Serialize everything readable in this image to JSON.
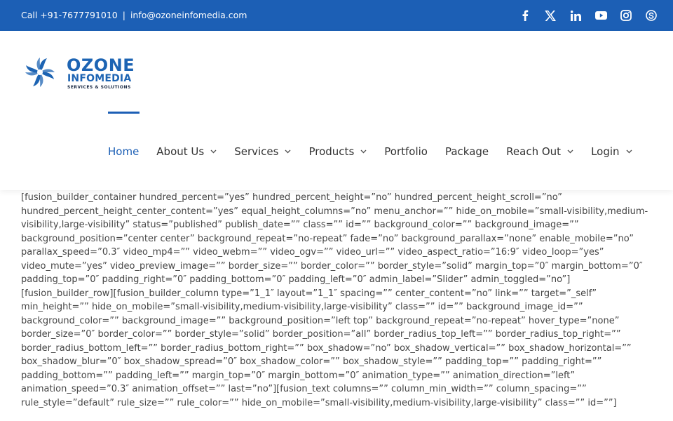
{
  "topbar": {
    "call_label": "Call +91-7677791010",
    "separator": "|",
    "email": "info@ozoneinfomedia.com",
    "social": [
      {
        "name": "facebook-icon"
      },
      {
        "name": "x-twitter-icon"
      },
      {
        "name": "linkedin-icon"
      },
      {
        "name": "youtube-icon"
      },
      {
        "name": "instagram-icon"
      },
      {
        "name": "skype-icon"
      }
    ]
  },
  "logo": {
    "line1": "OZONE",
    "line2": "INFOMEDIA",
    "line3": "SERVICES & SOLUTIONS"
  },
  "nav": {
    "items": [
      {
        "label": "Home",
        "active": true,
        "dropdown": false
      },
      {
        "label": "About Us",
        "dropdown": true
      },
      {
        "label": "Services",
        "dropdown": true
      },
      {
        "label": "Products",
        "dropdown": true
      },
      {
        "label": "Portfolio",
        "dropdown": false
      },
      {
        "label": "Package",
        "dropdown": false
      },
      {
        "label": "Reach Out",
        "dropdown": true
      },
      {
        "label": "Login",
        "dropdown": true
      }
    ]
  },
  "content": {
    "shortcode_text": "[fusion_builder_container hundred_percent=”yes” hundred_percent_height=”no” hundred_percent_height_scroll=”no” hundred_percent_height_center_content=”yes” equal_height_columns=”no” menu_anchor=”” hide_on_mobile=”small-visibility,medium-visibility,large-visibility” status=”published” publish_date=”” class=”” id=”” background_color=”” background_image=”” background_position=”center center” background_repeat=”no-repeat” fade=”no” background_parallax=”none” enable_mobile=”no” parallax_speed=”0.3″ video_mp4=”” video_webm=”” video_ogv=”” video_url=”” video_aspect_ratio=”16:9″ video_loop=”yes” video_mute=”yes” video_preview_image=”” border_size=”” border_color=”” border_style=”solid” margin_top=”0″ margin_bottom=”0″ padding_top=”0″ padding_right=”0″ padding_bottom=”0″ padding_left=”0″ admin_label=”Slider” admin_toggled=”no”][fusion_builder_row][fusion_builder_column type=”1_1″ layout=”1_1″ spacing=”” center_content=”no” link=”” target=”_self” min_height=”” hide_on_mobile=”small-visibility,medium-visibility,large-visibility” class=”” id=”” background_image_id=”” background_color=”” background_image=”” background_position=”left top” background_repeat=”no-repeat” hover_type=”none” border_size=”0″ border_color=”” border_style=”solid” border_position=”all” border_radius_top_left=”” border_radius_top_right=”” border_radius_bottom_left=”” border_radius_bottom_right=”” box_shadow=”no” box_shadow_vertical=”” box_shadow_horizontal=”” box_shadow_blur=”0″ box_shadow_spread=”0″ box_shadow_color=”” box_shadow_style=”” padding_top=”” padding_right=”” padding_bottom=”” padding_left=”” margin_top=”0″ margin_bottom=”0″ animation_type=”” animation_direction=”left” animation_speed=”0.3″ animation_offset=”” last=”no”][fusion_text columns=”” column_min_width=”” column_spacing=”” rule_style=”default” rule_size=”” rule_color=”” hide_on_mobile=”small-visibility,medium-visibility,large-visibility” class=”” id=””]"
  },
  "colors": {
    "brand_blue": "#1c5fb5",
    "text": "#444444",
    "nav_text": "#333333"
  }
}
